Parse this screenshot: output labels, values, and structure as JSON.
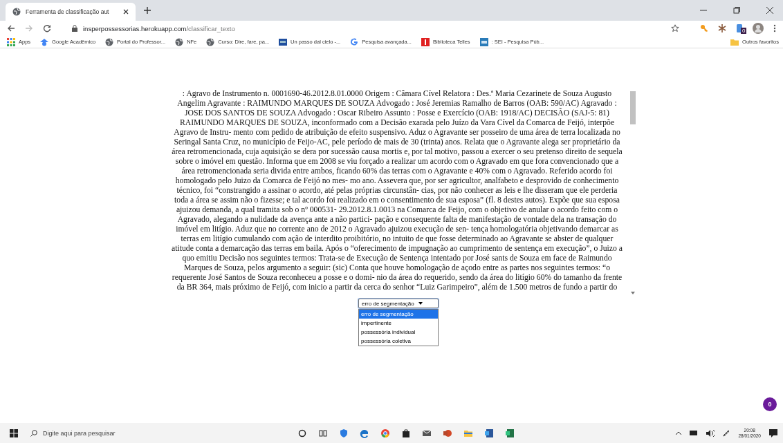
{
  "browser": {
    "tabs": [
      {
        "title": "Ferramenta de classificação aut",
        "selected": true
      }
    ],
    "address": {
      "host": "insperpossessorias.herokuapp.com",
      "path": "/classificar_texto"
    },
    "bookmarks": [
      {
        "label": "Apps",
        "kind": "apps"
      },
      {
        "label": "Google Acadêmico",
        "kind": "scholar"
      },
      {
        "label": "Portal do Professor...",
        "kind": "globe"
      },
      {
        "label": "NFe",
        "kind": "globe"
      },
      {
        "label": "Curso: Dire, fare, pa...",
        "kind": "globe"
      },
      {
        "label": "Un passo dal cielo -...",
        "kind": "tv"
      },
      {
        "label": "Pesquisa avançada...",
        "kind": "google"
      },
      {
        "label": "Biblioteca Telles",
        "kind": "library"
      },
      {
        "label": ": SEI - Pesquisa Púb...",
        "kind": "sei"
      }
    ],
    "other_bookmarks": "Outros favoritos",
    "extension_badge": "0"
  },
  "page": {
    "document_lines": [
      ": Agravo de Instrumento n. 0001690-46.2012.8.01.0000 Origem : Câmara Cível Relatora : Des.ª Maria Cezarinete de Souza Augusto",
      "Angelim Agravante : RAIMUNDO MARQUES DE SOUZA Advogado : José Jeremias Ramalho de Barros (OAB: 590/AC) Agravado :",
      "JOSE DOS SANTOS DE SOUZA Advogado : Oscar Ribeiro Assunto : Posse e Exercício (OAB: 1918/AC) DECISÃO (SAJ-5: 81)",
      "RAIMUNDO MARQUES DE SOUZA, inconformado com a Decisão exarada pelo Juízo da Vara Cível da Comarca de Feijó, interpõe",
      "Agravo de Instru- mento com pedido de atribuição de efeito suspensivo. Aduz o Agravante ser posseiro de uma área de terra localizada no",
      "Seringal Santa Cruz, no município de Feijo-AC, pele período de mais de 30 (trinta) anos. Relata que o Agravante alega ser proprietário da",
      "área retromencionada, cuja aquisição se dera por sucessão causa mortis e, por tal motivo, passou a exercer o seu pretenso direito de sequela",
      "sobre o imóvel em questão. Informa que em 2008 se viu forçado a realizar um acordo com o Agravado em que fora convencionado que a",
      "área retromencionada seria divida entre ambos, ficando 60% das terras com o Agravante e 40% com o Agravado. Referido acordo foi",
      "homologado pelo Juizo da Comarca de Feijó no mes- mo ano. Assevera que, por ser agricultor, analfabeto e desprovido de conhecimento",
      "técnico, foi “constrangido a assinar o acordo, até pelas próprias circunstân- cias, por não conhecer as leis e lhe disseram que ele perderia",
      "toda a área se assim não o fizesse; e tal acordo foi realizado em o consentimento de sua esposa” (fl. 8 destes autos). Expõe que sua esposa",
      "ajuizou demanda, a qual tramita sob o nº 000531- 29.2012.8.1.0013 na Comarca de Feijo, com o objetivo de anular o acordo feito com o",
      "Agravado, alegando a nulidade da avença ante a não partici- pação e consequente falta de manifestação de vontade dela na transação do",
      "imóvel em litígio. Aduz que no corrente ano de 2012 o Agravado ajuizou execução de sen- tença homologatória objetivando demarcar as",
      "terras em litígio cumulando com ação de interdito proibitório, no intuito de que fosse determinado ao Agravante se abster de qualquer",
      "atitude conta a demarcação das terras em baila. Após o “oferecimento de impugnação ao cumprimento de sentença em execução”, o Juizo a",
      "quo emitiu Decisão nos seguintes termos: Trata-se de Execução de Sentença intentado por José sants de Souza em face de Raimundo",
      "Marques de Souza, pelos argumento a seguir: (sic) Conta que houve homologação de açodo entre as partes nos seguintes termos: “o",
      "requerente José Santos de Souza reconheceu a posse e o domi- nio da área do requerido, sendo da área do litígio 60% do tamanho da frente",
      "da BR 364, mais próximo de Feijó, com inicio a partir da cerca do senhor “Luiz Garimpeiro”, além de 1.500 metros de fundo a partir do"
    ],
    "select": {
      "value": "erro de segmentação",
      "expanded": true,
      "options": [
        {
          "label": "erro de segmentação",
          "selected": true
        },
        {
          "label": "impertinente",
          "selected": false
        },
        {
          "label": "possessória individual",
          "selected": false
        },
        {
          "label": "possessória coletiva",
          "selected": false
        }
      ]
    },
    "badge": "0"
  },
  "taskbar": {
    "search_placeholder": "Digite aqui para pesquisar",
    "time": "20:08",
    "date": "28/01/2020"
  }
}
